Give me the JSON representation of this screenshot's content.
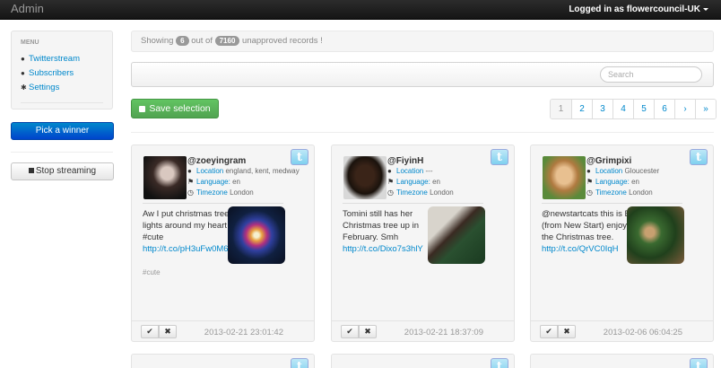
{
  "navbar": {
    "brand": "Admin",
    "user_label": "Logged in as flowercouncil-UK"
  },
  "sidebar": {
    "header": "MENU",
    "items": [
      {
        "label": "Twitterstream",
        "icon": "globe-icon"
      },
      {
        "label": "Subscribers",
        "icon": "user-icon"
      },
      {
        "label": "Settings",
        "icon": "gear-icon"
      }
    ],
    "pick_winner": "Pick a winner",
    "stop_streaming": "Stop streaming"
  },
  "status": {
    "prefix": "Showing",
    "shown": "6",
    "middle": "out of",
    "total": "7160",
    "suffix": "unapproved records !"
  },
  "search": {
    "placeholder": "Search",
    "value": ""
  },
  "save_selection": "Save selection",
  "pagination": [
    "1",
    "2",
    "3",
    "4",
    "5",
    "6",
    "›",
    "»"
  ],
  "meta_labels": {
    "location": "Location",
    "language": "Language:",
    "timezone": "Timezone"
  },
  "cards": [
    {
      "username": "@zoeyingram",
      "location": "england, kent, medway",
      "language": "en",
      "timezone": "London",
      "tweet": "Aw I put christmas tree lights around my heart thing #cute",
      "link": "http://t.co/pH3uFw0M6Z",
      "hashtag": "#cute",
      "timestamp": "2013-02-21 23:01:42"
    },
    {
      "username": "@FiyinH",
      "location": "---",
      "language": "en",
      "timezone": "London",
      "tweet": "Tomini still has her Christmas tree up in February. Smh",
      "link": "http://t.co/Dixo7s3hlY",
      "hashtag": "",
      "timestamp": "2013-02-21 18:37:09"
    },
    {
      "username": "@Grimpixi",
      "location": "Gloucester",
      "language": "en",
      "timezone": "London",
      "tweet": "@newstartcats this is Elvira (from New Start) enjoying the Christmas tree.",
      "link": "http://t.co/QrVC0IqH",
      "hashtag": "",
      "timestamp": "2013-02-06 06:04:25"
    }
  ],
  "colors": {
    "navbar": "#1b1b1b",
    "primary": "#0088cc",
    "success": "#5bb75b",
    "link": "#0088cc"
  }
}
